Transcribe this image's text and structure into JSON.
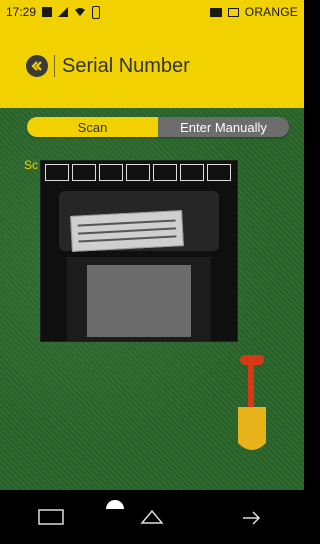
{
  "status_bar": {
    "time": "17:29",
    "carrier": "ORANGE"
  },
  "header": {
    "title": "Serial Number"
  },
  "segmented_control": {
    "scan_label": "Scan",
    "manual_label": "Enter Manually",
    "selected": "Scan"
  },
  "scan_hint": "Sc",
  "icons": {
    "back": "chevron-left-circle-icon",
    "recents": "recents-icon",
    "home": "home-icon",
    "back_nav": "back-nav-icon"
  },
  "colors": {
    "brand_yellow": "#f2d100",
    "segment_inactive": "#6d6d6d",
    "camera_green": "#2d6a2d",
    "nav_bg": "#000000"
  }
}
